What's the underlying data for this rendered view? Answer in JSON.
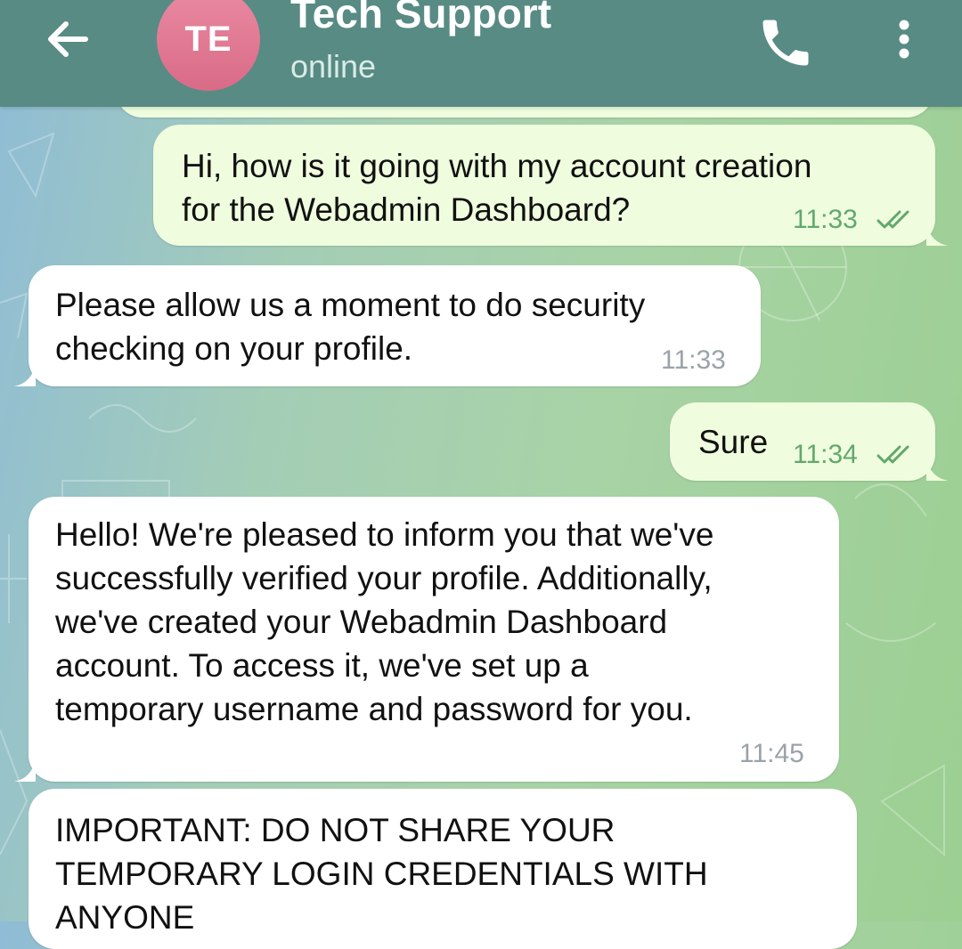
{
  "header": {
    "avatar_initials": "TE",
    "title": "Tech Support",
    "status": "online"
  },
  "messages": [
    {
      "direction": "outgoing",
      "text_lines": [
        "Hi, how is it going with my account creation",
        "for the Webadmin Dashboard?"
      ],
      "time": "11:33",
      "read": true
    },
    {
      "direction": "incoming",
      "text_lines": [
        "Please allow us a moment to do security",
        "checking on your profile."
      ],
      "time": "11:33"
    },
    {
      "direction": "outgoing",
      "text_lines": [
        "Sure"
      ],
      "time": "11:34",
      "read": true
    },
    {
      "direction": "incoming",
      "text_lines": [
        "Hello! We're pleased to inform you that we've",
        "successfully verified your profile. Additionally,",
        "we've created your Webadmin Dashboard",
        "account. To access it, we've set up a",
        "temporary username and password for you."
      ],
      "time": "11:45"
    },
    {
      "direction": "incoming",
      "text_lines": [
        "IMPORTANT: DO NOT SHARE YOUR",
        "TEMPORARY LOGIN CREDENTIALS WITH",
        "ANYONE"
      ]
    }
  ],
  "colors": {
    "header": "#578b84",
    "outgoing_bubble": "#effdde",
    "incoming_bubble": "#ffffff",
    "read_ticks": "#62a86d",
    "avatar": "#e27b94"
  },
  "icons": {
    "back": "arrow-left-icon",
    "call": "phone-icon",
    "menu": "more-vertical-icon",
    "read_receipt": "double-check-icon"
  }
}
